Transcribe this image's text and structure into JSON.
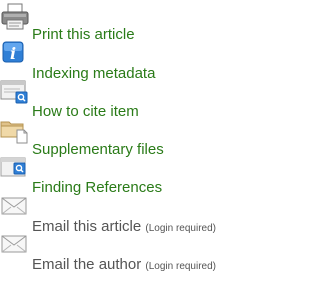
{
  "tools": [
    {
      "label": "Print this article",
      "icon": "printer-icon",
      "link": true
    },
    {
      "label": "Indexing metadata",
      "icon": "info-icon",
      "link": true
    },
    {
      "label": "How to cite item",
      "icon": "cite-document-icon",
      "link": true
    },
    {
      "label": "Supplementary files",
      "icon": "folder-icon",
      "link": true
    },
    {
      "label": "Finding References",
      "icon": "search-references-icon",
      "link": true
    },
    {
      "label": "Email this article",
      "note": "(Login required)",
      "icon": "envelope-icon",
      "link": false
    },
    {
      "label": "Email the author",
      "note": "(Login required)",
      "icon": "envelope-icon",
      "link": false
    }
  ],
  "colors": {
    "link": "#2a7b18",
    "disabled_text": "#555555"
  }
}
